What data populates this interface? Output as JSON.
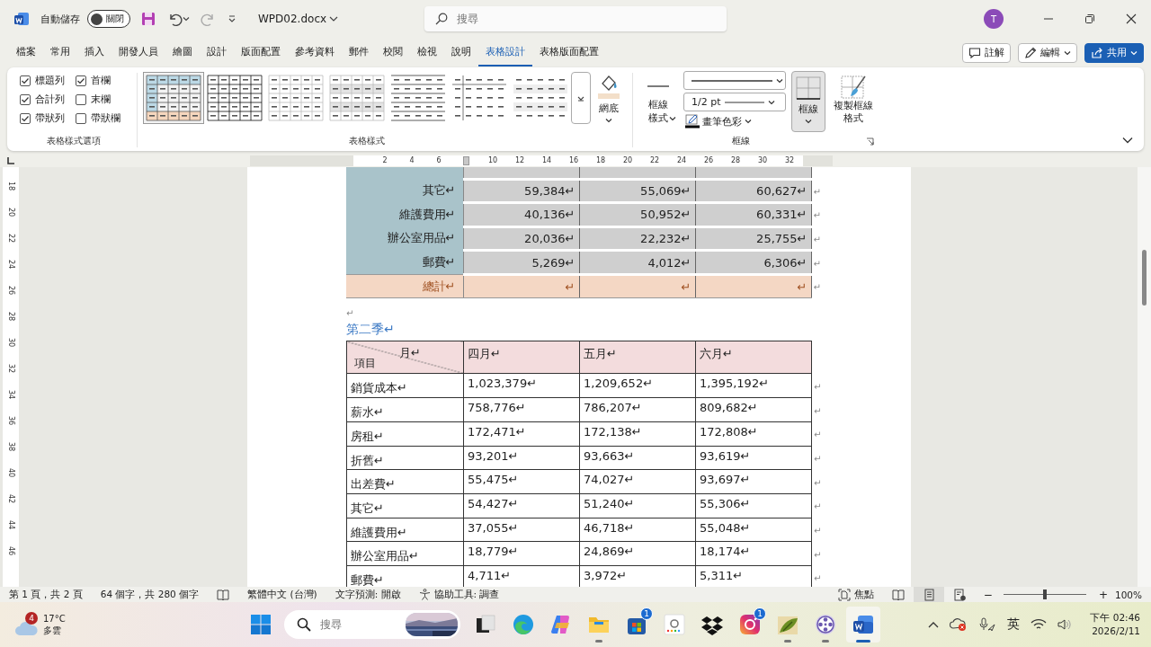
{
  "title_bar": {
    "autosave_label": "自動儲存",
    "autosave": {
      "on": false,
      "label": "關閉"
    },
    "filename": "WPD02.docx",
    "search": {
      "placeholder": "搜尋"
    },
    "avatar": "T"
  },
  "menu_tabs": [
    {
      "label": "檔案",
      "selected": false
    },
    {
      "label": "常用",
      "selected": false
    },
    {
      "label": "插入",
      "selected": false
    },
    {
      "label": "開發人員",
      "selected": false
    },
    {
      "label": "繪圖",
      "selected": false
    },
    {
      "label": "設計",
      "selected": false
    },
    {
      "label": "版面配置",
      "selected": false
    },
    {
      "label": "參考資料",
      "selected": false
    },
    {
      "label": "郵件",
      "selected": false
    },
    {
      "label": "校閱",
      "selected": false
    },
    {
      "label": "檢視",
      "selected": false
    },
    {
      "label": "說明",
      "selected": false
    },
    {
      "label": "表格設計",
      "selected": true
    },
    {
      "label": "表格版面配置",
      "selected": false
    }
  ],
  "header_buttons": [
    {
      "label": "註解",
      "kind": "comment"
    },
    {
      "label": "編輯",
      "kind": "edit"
    },
    {
      "label": "共用",
      "kind": "share"
    }
  ],
  "ribbon": {
    "style_options": {
      "label": "表格樣式選項",
      "items": [
        {
          "label": "標題列",
          "checked": true
        },
        {
          "label": "首欄",
          "checked": true
        },
        {
          "label": "合計列",
          "checked": true
        },
        {
          "label": "末欄",
          "checked": false
        },
        {
          "label": "帶狀列",
          "checked": true
        },
        {
          "label": "帶狀欄",
          "checked": false
        }
      ]
    },
    "table_styles": {
      "label": "表格樣式",
      "items": [
        {
          "kind": "colorful",
          "selected": true
        },
        {
          "kind": "grid",
          "selected": false
        },
        {
          "kind": "light-grid",
          "selected": false
        },
        {
          "kind": "shaded-grid",
          "selected": false
        },
        {
          "kind": "lines",
          "selected": false
        },
        {
          "kind": "first-column",
          "selected": false
        },
        {
          "kind": "plain",
          "selected": false
        }
      ]
    },
    "shading": {
      "label": "網底"
    },
    "borders": {
      "label": "框線",
      "style_label": "框線樣式",
      "width": "1/2 pt",
      "pen_color_label": "畫筆色彩",
      "borders_button": {
        "label": "框線",
        "selected": true
      },
      "painter_label": "複製框線格式"
    }
  },
  "ruler": {
    "h_ticks": [
      {
        "label": "2"
      },
      {
        "label": "4"
      },
      {
        "label": "6"
      },
      {
        "kind": "marker"
      },
      {
        "label": "10"
      },
      {
        "label": "12"
      },
      {
        "label": "14"
      },
      {
        "label": "16"
      },
      {
        "label": "18"
      },
      {
        "label": "20"
      },
      {
        "label": "22"
      },
      {
        "label": "24"
      },
      {
        "label": "26"
      },
      {
        "label": "28"
      },
      {
        "label": "30"
      },
      {
        "label": "32"
      }
    ],
    "v_labels": [
      "18",
      "20",
      "22",
      "24",
      "26",
      "28",
      "30",
      "32",
      "34",
      "36",
      "38",
      "40",
      "42",
      "44",
      "46"
    ]
  },
  "document": {
    "table_1": {
      "rows": [
        {
          "kind": "cut"
        },
        {
          "kind": "data",
          "cells": [
            "其它↵",
            "59,384↵",
            "55,069↵",
            "60,627↵"
          ],
          "end": "↵"
        },
        {
          "kind": "data",
          "cells": [
            "維護費用↵",
            "40,136↵",
            "50,952↵",
            "60,331↵"
          ],
          "end": "↵"
        },
        {
          "kind": "data",
          "cells": [
            "辦公室用品↵",
            "20,036↵",
            "22,232↵",
            "25,755↵"
          ],
          "end": "↵"
        },
        {
          "kind": "data",
          "cells": [
            "郵費↵",
            "5,269↵",
            "4,012↵",
            "6,306↵"
          ],
          "end": "↵"
        },
        {
          "kind": "total",
          "cells": [
            "總計↵",
            "↵",
            "↵",
            "↵"
          ],
          "end": "↵"
        }
      ]
    },
    "empty_paragraph": "↵",
    "heading": "第二季↵",
    "table_2": {
      "columns": [
        {
          "kind": "corner",
          "top": "月↵",
          "bottom": "項目"
        },
        {
          "kind": "label",
          "label": "四月↵"
        },
        {
          "kind": "label",
          "label": "五月↵"
        },
        {
          "kind": "label",
          "label": "六月↵"
        }
      ],
      "rows": [
        {
          "cells": [
            "銷貨成本↵",
            "1,023,379↵",
            "1,209,652↵",
            "1,395,192↵"
          ],
          "end": "↵"
        },
        {
          "cells": [
            "薪水↵",
            "758,776↵",
            "786,207↵",
            "809,682↵"
          ],
          "end": "↵"
        },
        {
          "cells": [
            "房租↵",
            "172,471↵",
            "172,138↵",
            "172,808↵"
          ],
          "end": "↵"
        },
        {
          "cells": [
            "折舊↵",
            "93,201↵",
            "93,663↵",
            "93,619↵"
          ],
          "end": "↵"
        },
        {
          "cells": [
            "出差費↵",
            "55,475↵",
            "74,027↵",
            "93,697↵"
          ],
          "end": "↵"
        },
        {
          "cells": [
            "其它↵",
            "54,427↵",
            "51,240↵",
            "55,306↵"
          ],
          "end": "↵"
        },
        {
          "cells": [
            "維護費用↵",
            "37,055↵",
            "46,718↵",
            "55,048↵"
          ],
          "end": "↵"
        },
        {
          "cells": [
            "辦公室用品↵",
            "18,779↵",
            "24,869↵",
            "18,174↵"
          ],
          "end": "↵"
        },
        {
          "cells": [
            "郵費↵",
            "4,711↵",
            "3,972↵",
            "5,311↵"
          ],
          "end": "↵"
        }
      ]
    }
  },
  "status_bar": {
    "page": "第 1 頁，共 2 頁",
    "words": "64 個字，共 280 個字",
    "language": "繁體中文 (台灣)",
    "prediction": "文字預測: 開啟",
    "accessibility": "協助工具: 調查",
    "focus": "焦點",
    "views": [
      {
        "kind": "read",
        "selected": false
      },
      {
        "kind": "print",
        "selected": true
      },
      {
        "kind": "web",
        "selected": false
      }
    ],
    "zoom": {
      "out": "−",
      "in": "+",
      "level": 0.5,
      "value": "100%"
    }
  },
  "taskbar": {
    "weather": {
      "badge": "4",
      "temp": "17°C",
      "desc": "多雲"
    },
    "search": {
      "placeholder": "搜尋"
    },
    "apps": [
      {
        "kind": "task-view",
        "running": false,
        "active": false
      },
      {
        "kind": "edge",
        "running": false,
        "active": false
      },
      {
        "kind": "copilot",
        "running": false,
        "active": false
      },
      {
        "kind": "folder",
        "running": true,
        "active": false
      },
      {
        "kind": "store",
        "badge": "1",
        "running": false,
        "active": false
      },
      {
        "kind": "dots",
        "running": false,
        "active": false
      },
      {
        "kind": "dropbox",
        "running": false,
        "active": false
      },
      {
        "kind": "camera",
        "badge": "1",
        "running": false,
        "active": false
      },
      {
        "kind": "leaf",
        "running": true,
        "active": false
      },
      {
        "kind": "reel",
        "running": true,
        "active": false
      },
      {
        "kind": "word",
        "running": true,
        "active": true
      }
    ],
    "ime": "英",
    "time": "下午 02:46",
    "date": "2026/2/11"
  }
}
